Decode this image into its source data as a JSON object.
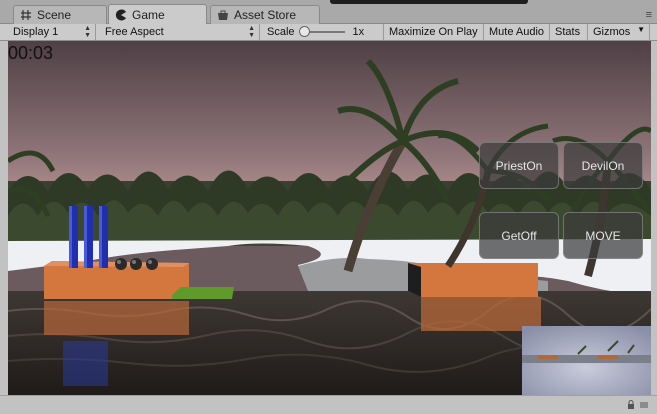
{
  "tabs": [
    {
      "label": "Scene",
      "icon": "grid-icon"
    },
    {
      "label": "Game",
      "icon": "pacman-icon"
    },
    {
      "label": "Asset Store",
      "icon": "store-icon"
    }
  ],
  "tab_menu": "≡",
  "toolbar": {
    "display": "Display 1",
    "aspect": "Free Aspect",
    "scale_label": "Scale",
    "scale_value": "1x",
    "maximize": "Maximize On Play",
    "mute": "Mute Audio",
    "stats": "Stats",
    "gizmos": "Gizmos"
  },
  "game": {
    "timer": "00:03",
    "buttons": {
      "priest_on": "PriestOn",
      "devil_on": "DevilOn",
      "get_off": "GetOff",
      "move": "MOVE"
    }
  },
  "colors": {
    "sky_top": "#57464b",
    "sky_horizon": "#c9a2a1",
    "snow": "#f2f3f5",
    "water": "#2b2622",
    "bank": "#d4773e",
    "boat": "#5f9a2b",
    "priest": "#1f2fb0"
  }
}
